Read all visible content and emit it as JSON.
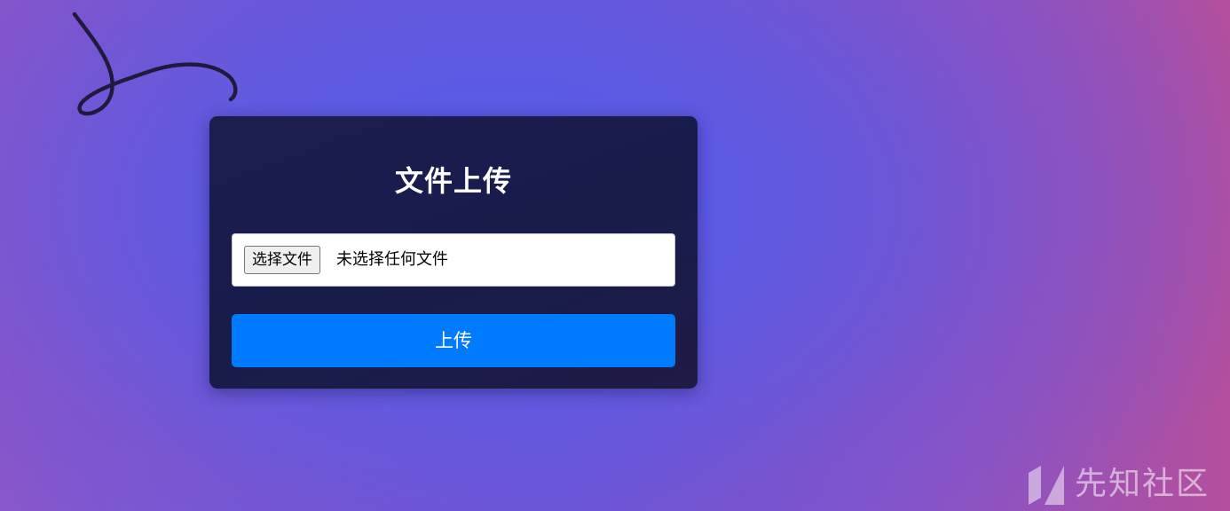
{
  "page": {
    "background_colors": [
      "#8e59c9",
      "#5d5ce6",
      "#b44f9d"
    ]
  },
  "decoration": {
    "scribble_icon": "pen-scribble-icon"
  },
  "upload_card": {
    "title": "文件上传",
    "file_input": {
      "choose_button_label": "选择文件",
      "status_text": "未选择任何文件"
    },
    "upload_button_label": "上传",
    "colors": {
      "card_background": "#1b1d4e",
      "button_background": "#007bff",
      "title_color": "#ffffff"
    }
  },
  "watermark": {
    "logo_icon": "xianzhi-logo-icon",
    "text": "先知社区"
  }
}
